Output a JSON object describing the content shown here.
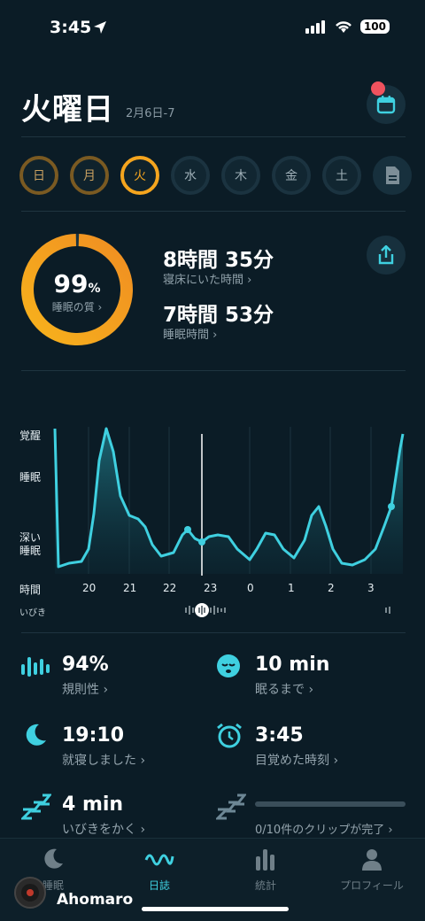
{
  "status": {
    "time": "3:45",
    "battery": "100"
  },
  "header": {
    "day": "火曜日",
    "date_range": "2月6日-7"
  },
  "week": [
    {
      "label": "日",
      "state": "done"
    },
    {
      "label": "月",
      "state": "done"
    },
    {
      "label": "火",
      "state": "active"
    },
    {
      "label": "水",
      "state": "empty"
    },
    {
      "label": "木",
      "state": "empty"
    },
    {
      "label": "金",
      "state": "empty"
    },
    {
      "label": "土",
      "state": "empty"
    }
  ],
  "quality": {
    "value": "99",
    "unit": "%",
    "label": "睡眠の質 ›",
    "progress": 0.99
  },
  "in_bed": {
    "value": "8時間 35分",
    "label": "寝床にいた時間 ›"
  },
  "asleep": {
    "value": "7時間 53分",
    "label": "睡眠時間 ›"
  },
  "chart": {
    "y_labels": [
      "覚醒",
      "睡眠",
      "深い\n睡眠"
    ],
    "y_awake": "覚醒",
    "y_sleep": "睡眠",
    "y_deep1": "深い",
    "y_deep2": "睡眠",
    "x_title": "時間",
    "x_ticks": [
      "20",
      "21",
      "22",
      "23",
      "0",
      "1",
      "2",
      "3"
    ],
    "snore_label": "いびき"
  },
  "metrics": {
    "regularity": {
      "value": "94%",
      "label": "規則性 ›"
    },
    "fall_asleep": {
      "value": "10 min",
      "label": "眠るまで ›"
    },
    "bedtime": {
      "value": "19:10",
      "label": "就寝しました ›"
    },
    "wakeup": {
      "value": "3:45",
      "label": "目覚めた時刻 ›"
    },
    "snoring": {
      "value": "4 min",
      "label": "いびきをかく ›"
    },
    "clips": {
      "label": "0/10件のクリップが完了 ›"
    }
  },
  "tabs": [
    {
      "label": "睡眠"
    },
    {
      "label": "日誌"
    },
    {
      "label": "統計"
    },
    {
      "label": "プロフィール"
    }
  ],
  "watermark": {
    "text": "Ahomaro"
  },
  "colors": {
    "accent": "#f5a51e",
    "teal": "#3fd0e0",
    "bg": "#0b1c26"
  }
}
